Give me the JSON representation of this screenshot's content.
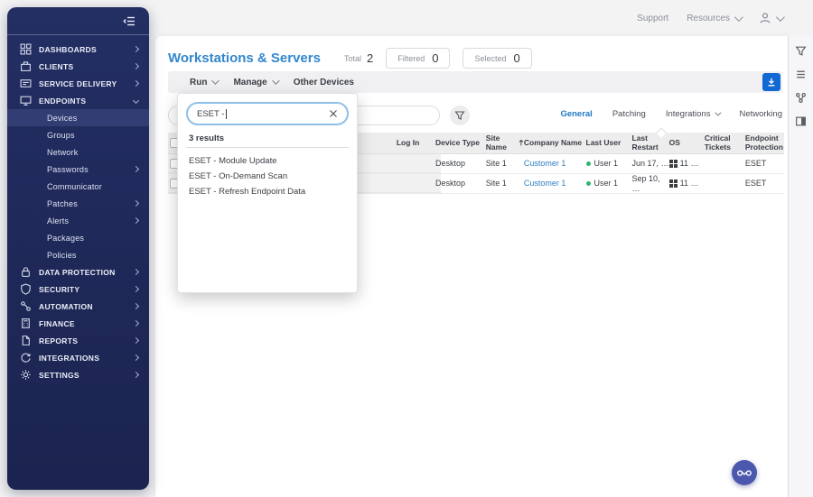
{
  "topbar": {
    "support": "Support",
    "resources": "Resources"
  },
  "sidebar": {
    "items": [
      {
        "label": "DASHBOARDS"
      },
      {
        "label": "CLIENTS"
      },
      {
        "label": "SERVICE DELIVERY"
      },
      {
        "label": "ENDPOINTS"
      }
    ],
    "endpoints_children": [
      {
        "label": "Devices"
      },
      {
        "label": "Groups"
      },
      {
        "label": "Network"
      },
      {
        "label": "Passwords"
      },
      {
        "label": "Communicator"
      },
      {
        "label": "Patches"
      },
      {
        "label": "Alerts"
      },
      {
        "label": "Packages"
      },
      {
        "label": "Policies"
      }
    ],
    "items2": [
      {
        "label": "DATA PROTECTION"
      },
      {
        "label": "SECURITY"
      },
      {
        "label": "AUTOMATION"
      },
      {
        "label": "FINANCE"
      },
      {
        "label": "REPORTS"
      },
      {
        "label": "INTEGRATIONS"
      },
      {
        "label": "SETTINGS"
      }
    ]
  },
  "header": {
    "title": "Workstations & Servers",
    "total_label": "Total",
    "total_value": "2",
    "filtered_label": "Filtered",
    "filtered_value": "0",
    "selected_label": "Selected",
    "selected_value": "0"
  },
  "toolbar": {
    "run": "Run",
    "manage": "Manage",
    "other_devices": "Other Devices"
  },
  "tabs": {
    "general": "General",
    "patching": "Patching",
    "integrations": "Integrations",
    "networking": "Networking"
  },
  "run_search_panel": {
    "query": "ESET -",
    "results_label": "3 results",
    "results": [
      {
        "label": "ESET - Module Update"
      },
      {
        "label": "ESET - On-Demand Scan"
      },
      {
        "label": "ESET - Refresh Endpoint Data"
      }
    ]
  },
  "table": {
    "headers": [
      {
        "label": "Log In"
      },
      {
        "label": "Device Type"
      },
      {
        "label": "Site Name",
        "sorted": "asc"
      },
      {
        "label": "Company Name"
      },
      {
        "label": "Last User"
      },
      {
        "label": "Last Restart"
      },
      {
        "label": "OS"
      },
      {
        "label": "Critical Tickets"
      },
      {
        "label": "Endpoint Protection"
      }
    ],
    "rows": [
      {
        "device_type": "Desktop",
        "site_name": "Site 1",
        "company_name": "Customer 1",
        "last_user": "User 1",
        "last_restart": "Jun 17, …",
        "os": "11 …",
        "critical_tickets": "",
        "endpoint_protection": "ESET",
        "user_status": "online"
      },
      {
        "device_type": "Desktop",
        "site_name": "Site 1",
        "company_name": "Customer 1",
        "last_user": "User 1",
        "last_restart": "Sep 10, …",
        "os": "11 …",
        "critical_tickets": "",
        "endpoint_protection": "ESET",
        "user_status": "online"
      }
    ]
  },
  "colors": {
    "title_blue": "#3287cd",
    "link_blue": "#2e7fc2",
    "sidebar_navy": "#212b5f",
    "download_blue": "#1269d3",
    "assistant_indigo": "#4c58ae",
    "online_green": "#2eb472"
  }
}
